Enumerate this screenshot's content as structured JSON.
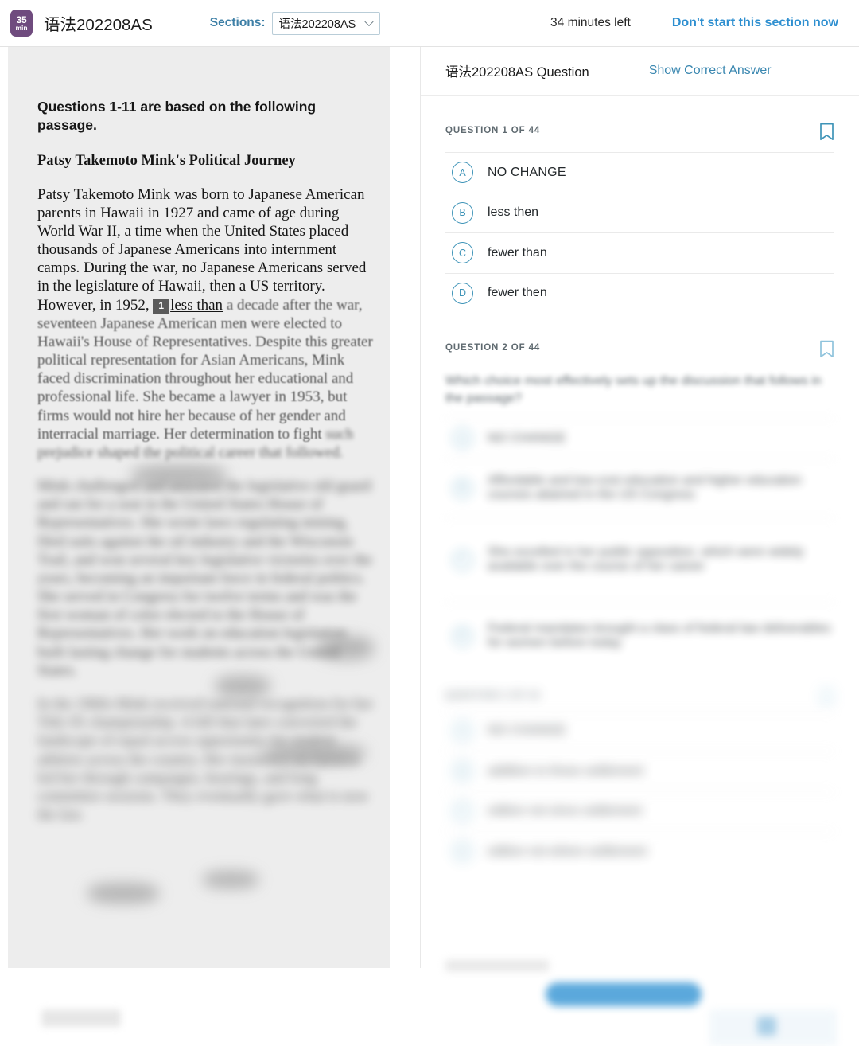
{
  "header": {
    "timer_badge": {
      "value": "35",
      "unit": "min"
    },
    "title": "语法202208AS",
    "sections_label": "Sections:",
    "sections_selected": "语法202208AS",
    "sections_options": [
      "语法202208AS"
    ],
    "time_left": "34 minutes left",
    "dont_start_label": "Don't start this section now",
    "accent_link_color": "#2e8fd0",
    "sections_label_color": "#3d7fa6",
    "timer_badge_color": "#6f4b7e"
  },
  "passage": {
    "questions_range_heading": "Questions 1-11 are based on the following passage.",
    "title": "Patsy Takemoto Mink's Political Journey",
    "paragraph_1_pre": "Patsy Takemoto Mink was born to Japanese American parents in Hawaii in 1927 and came of age during World War II, a time when the United States placed thousands of Japanese Americans into internment camps. During the war, no Japanese Americans served in the legislature of Hawaii, then a US territory. However, in 1952,",
    "inline_marker": "1",
    "inline_underlined": "less than",
    "paragraph_1_post": "a decade after the war, seventeen Japanese American men were elected to Hawaii's House of Representatives. Despite this greater political representation for Asian Americans, Mink faced discrimination throughout her educational and professional life. She became a lawyer in 1953, but firms would not hire her because of her gender and interracial marriage. Her determination to fight",
    "paragraph_1_tail": "such prejudice shaped the political career that followed.",
    "paragraph_2": "Mink challenged and unseated the legislative old guard and ran for a seat in the United States House of Representatives. She wrote laws regulating mining, filed suits against the oil industry and the Wisconsin Trail, and won several key legislative victories over the years, becoming an important force in federal politics. She served in Congress for twelve terms and was the first woman of color elected to the House of Representatives. Her work on education legislation built lasting change for students across the United States.",
    "paragraph_3": "In the 1960s Mink received national recognition for her Title IX championship. A bill that later converted the landscape of equal access opportunity for student athletes across the country. Her insistence on fairness led her through campaigns, hearings, and long committee sessions. They eventually gave what is now the law."
  },
  "question_panel": {
    "panel_title": "语法202208AS Question",
    "show_answer_label": "Show Correct Answer",
    "show_answer_color": "#3a87b0",
    "bookmark_icon": "bookmark-icon",
    "questions": [
      {
        "counter": "QUESTION 1 OF 44",
        "prompt": "",
        "choices": [
          {
            "letter": "A",
            "text": "NO CHANGE"
          },
          {
            "letter": "B",
            "text": "less then"
          },
          {
            "letter": "C",
            "text": "fewer than"
          },
          {
            "letter": "D",
            "text": "fewer then"
          }
        ]
      },
      {
        "counter": "QUESTION 2 OF 44",
        "prompt": "Which choice most effectively sets up the discussion that follows in the passage?",
        "choices": [
          {
            "letter": "A",
            "text": "NO CHANGE"
          },
          {
            "letter": "B",
            "text": "Affordable and low-cost education and higher education courses attained in the US Congress"
          },
          {
            "letter": "C",
            "text": "She excelled in her public opposition, which were widely available over the course of her career"
          },
          {
            "letter": "D",
            "text": "Federal mandates brought a class of federal law deliverables for women before today"
          }
        ]
      },
      {
        "counter": "QUESTION 3 OF 44",
        "prompt": "",
        "choices": [
          {
            "letter": "A",
            "text": "NO CHANGE"
          },
          {
            "letter": "B",
            "text": "addition to those settlement"
          },
          {
            "letter": "C",
            "text": "edition not since settlement"
          },
          {
            "letter": "D",
            "text": "edition not where settlement"
          }
        ]
      }
    ]
  },
  "footer": {
    "next_button_label": "",
    "pager_label": ""
  }
}
